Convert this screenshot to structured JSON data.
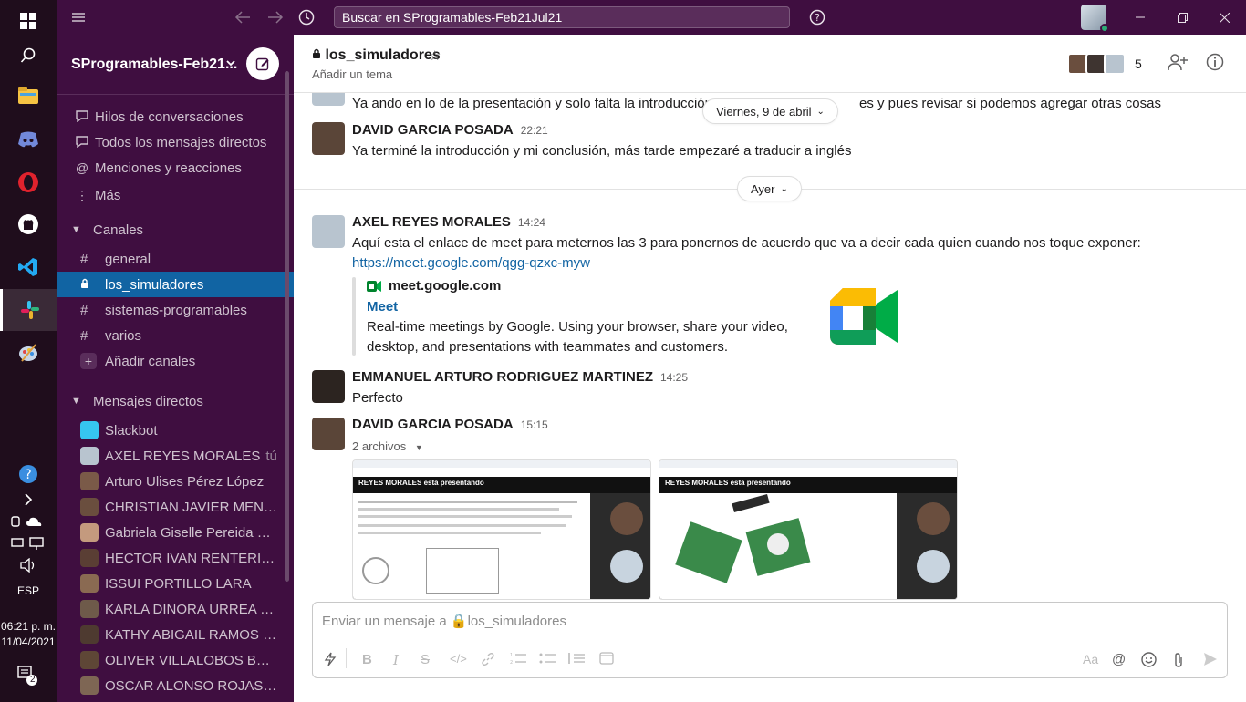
{
  "taskbar": {
    "language": "ESP",
    "time": "06:21 p. m.",
    "date": "11/04/2021",
    "notif_count": "2"
  },
  "topbar": {
    "search_placeholder": "Buscar en SProgramables-Feb21Jul21"
  },
  "sidebar": {
    "workspace": "SProgramables-Feb21...",
    "nav": [
      {
        "label": "Hilos de conversaciones"
      },
      {
        "label": "Todos los mensajes directos"
      },
      {
        "label": "Menciones y reacciones"
      },
      {
        "label": "Más"
      }
    ],
    "channels_header": "Canales",
    "channels": [
      {
        "label": "general"
      },
      {
        "label": "los_simuladores"
      },
      {
        "label": "sistemas-programables"
      },
      {
        "label": "varios"
      }
    ],
    "add_channels": "Añadir canales",
    "dm_header": "Mensajes directos",
    "dms": [
      {
        "label": "Slackbot",
        "color": "#36c5f0"
      },
      {
        "label": "AXEL REYES MORALES",
        "you": "tú",
        "color": "#b8c4cf"
      },
      {
        "label": "Arturo Ulises Pérez López",
        "color": "#7a5a48"
      },
      {
        "label": "CHRISTIAN JAVIER MEND...",
        "color": "#6a4e3e"
      },
      {
        "label": "Gabriela Giselle Pereida Ro...",
        "color": "#c49a7e"
      },
      {
        "label": "HECTOR IVAN RENTERIA ...",
        "color": "#5a3e34"
      },
      {
        "label": "ISSUI PORTILLO LARA",
        "color": "#8a6a52"
      },
      {
        "label": "KARLA DINORA URREA S...",
        "color": "#6e5a4a"
      },
      {
        "label": "KATHY ABIGAIL RAMOS R...",
        "color": "#4e3a30"
      },
      {
        "label": "OLIVER VILLALOBOS BEC...",
        "color": "#5e4636"
      },
      {
        "label": "OSCAR ALONSO ROJAS C...",
        "color": "#7e6654"
      }
    ]
  },
  "channel": {
    "title": "los_simuladores",
    "topic": "Añadir un tema",
    "member_count": "5"
  },
  "messages": {
    "partial_text": "Ya ando en lo de la presentación y solo falta la introducción",
    "partial_text_tail": "es y pues revisar si podemos agregar otras cosas",
    "date1": "Viernes, 9 de abril",
    "m1": {
      "name": "DAVID GARCIA POSADA",
      "time": "22:21",
      "text": "Ya terminé la introducción y mi conclusión, más tarde empezaré a traducir a inglés"
    },
    "date2": "Ayer",
    "m2": {
      "name": "AXEL REYES MORALES",
      "time": "14:24",
      "text": "Aquí esta el enlace de meet para meternos las 3 para ponernos de acuerdo que va a decir cada quien cuando nos toque exponer:",
      "link": "https://meet.google.com/qgg-qzxc-myw",
      "unfurl_domain": "meet.google.com",
      "unfurl_title": "Meet",
      "unfurl_desc1": "Real-time meetings by Google. Using your browser, share your video,",
      "unfurl_desc2": "desktop, and presentations with teammates and customers."
    },
    "m3": {
      "name": "EMMANUEL ARTURO RODRIGUEZ MARTINEZ",
      "time": "14:25",
      "text": "Perfecto"
    },
    "m4": {
      "name": "DAVID GARCIA POSADA",
      "time": "15:15",
      "files_label": "2 archivos",
      "file1_title": "REYES MORALES está presentando",
      "file2_title": "REYES MORALES está presentando"
    }
  },
  "composer": {
    "placeholder": "Enviar un mensaje a 🔒los_simuladores"
  }
}
